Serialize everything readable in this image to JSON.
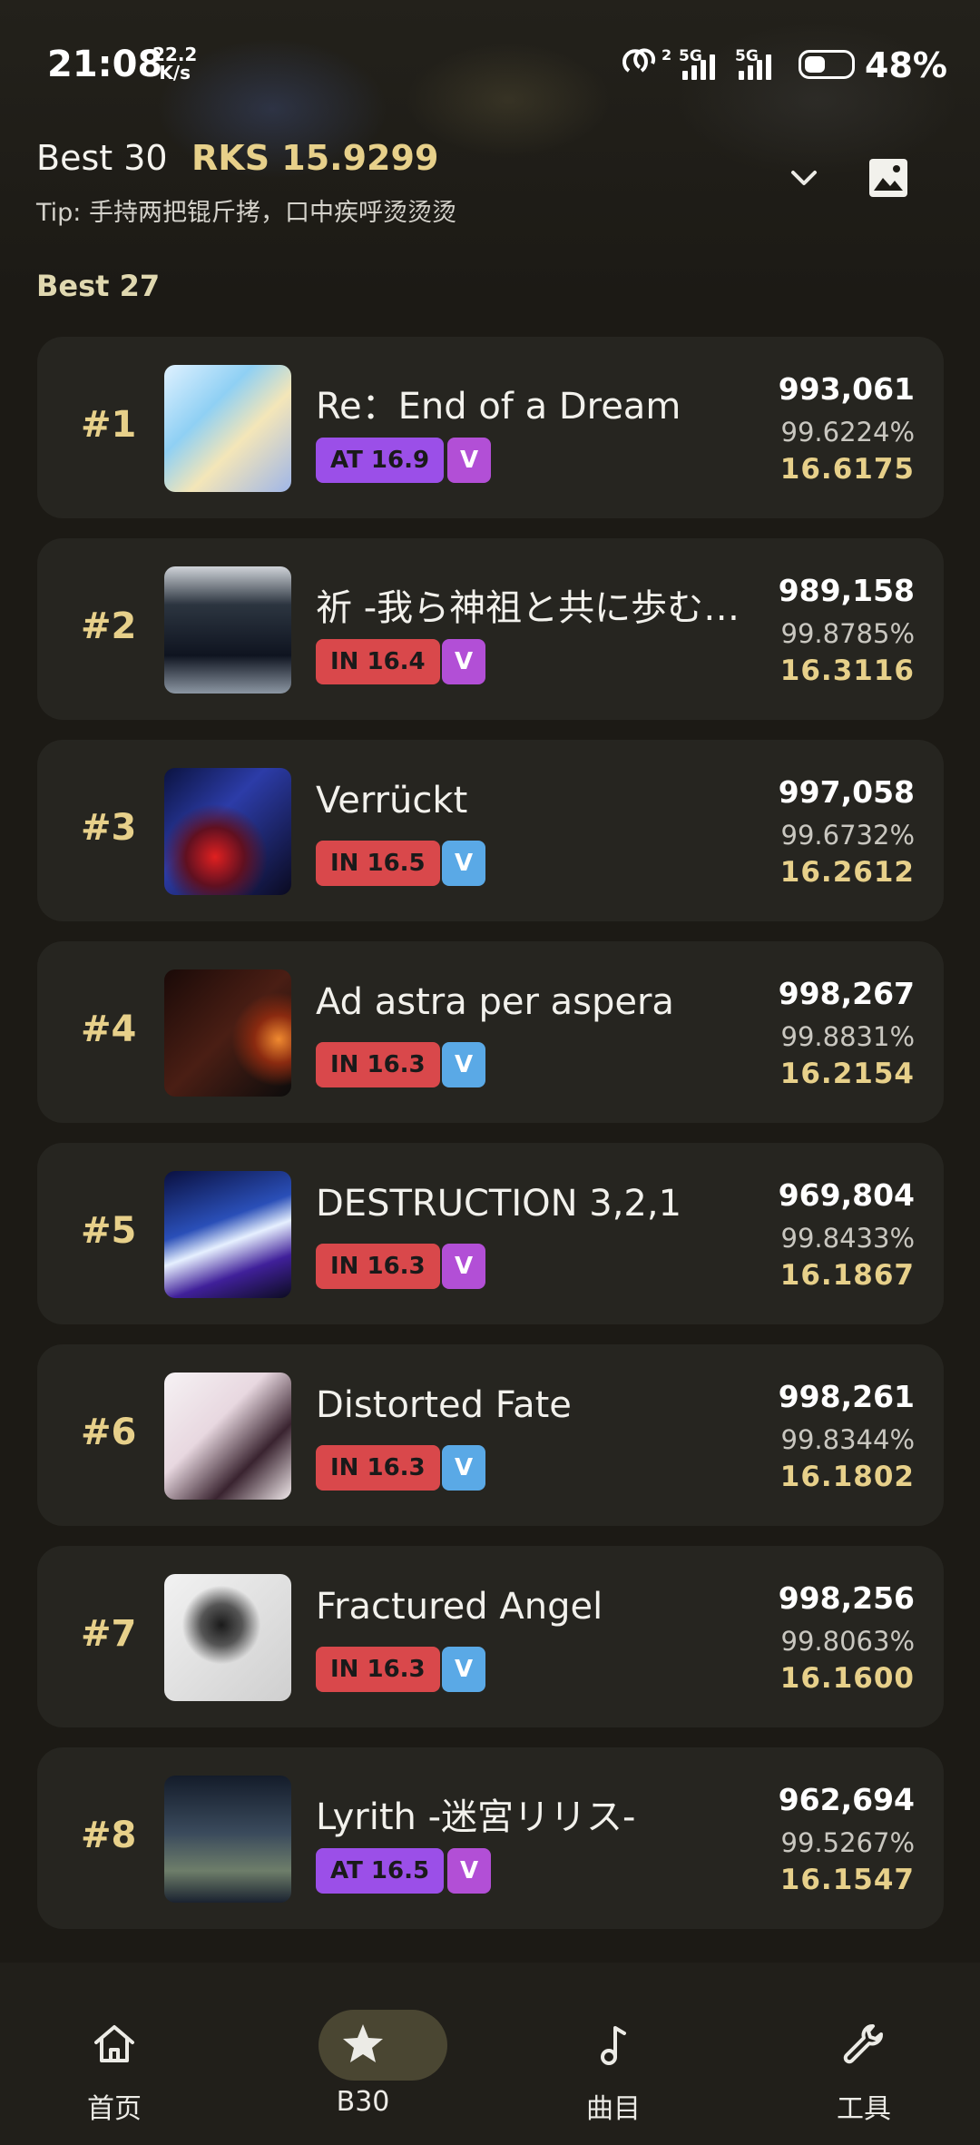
{
  "status_bar": {
    "time": "21:08",
    "net_speed_value": "22.2",
    "net_speed_unit": "K/s",
    "network_1": "5G",
    "network_2": "5G",
    "battery": "48%"
  },
  "header": {
    "title": "Best 30",
    "rks_label": "RKS 15.9299",
    "tip": "Tip: 手持两把锟斤拷，口中疾呼烫烫烫"
  },
  "section_label": "Best 27",
  "songs": [
    {
      "rank": "#1",
      "name": "Re：End of a Dream",
      "difficulty": "AT 16.9",
      "diff_type": "at",
      "badge": "V",
      "badge_color": "purple",
      "score": "993,061",
      "accuracy": "99.6224%",
      "rks": "16.6175"
    },
    {
      "rank": "#2",
      "name": "祈 -我ら神祖と共に歩む者なり-",
      "difficulty": "IN 16.4",
      "diff_type": "in",
      "badge": "V",
      "badge_color": "purple",
      "score": "989,158",
      "accuracy": "99.8785%",
      "rks": "16.3116"
    },
    {
      "rank": "#3",
      "name": "Verrückt",
      "difficulty": "IN 16.5",
      "diff_type": "in",
      "badge": "V",
      "badge_color": "blue",
      "score": "997,058",
      "accuracy": "99.6732%",
      "rks": "16.2612"
    },
    {
      "rank": "#4",
      "name": "Ad astra per aspera",
      "difficulty": "IN 16.3",
      "diff_type": "in",
      "badge": "V",
      "badge_color": "blue",
      "score": "998,267",
      "accuracy": "99.8831%",
      "rks": "16.2154"
    },
    {
      "rank": "#5",
      "name": "DESTRUCTION 3,2,1",
      "difficulty": "IN 16.3",
      "diff_type": "in",
      "badge": "V",
      "badge_color": "purple",
      "score": "969,804",
      "accuracy": "99.8433%",
      "rks": "16.1867"
    },
    {
      "rank": "#6",
      "name": "Distorted Fate",
      "difficulty": "IN 16.3",
      "diff_type": "in",
      "badge": "V",
      "badge_color": "blue",
      "score": "998,261",
      "accuracy": "99.8344%",
      "rks": "16.1802"
    },
    {
      "rank": "#7",
      "name": "Fractured Angel",
      "difficulty": "IN 16.3",
      "diff_type": "in",
      "badge": "V",
      "badge_color": "blue",
      "score": "998,256",
      "accuracy": "99.8063%",
      "rks": "16.1600"
    },
    {
      "rank": "#8",
      "name": "Lyrith -迷宮リリス-",
      "difficulty": "AT 16.5",
      "diff_type": "at",
      "badge": "V",
      "badge_color": "purple",
      "score": "962,694",
      "accuracy": "99.5267%",
      "rks": "16.1547"
    }
  ],
  "nav": [
    {
      "label": "首页",
      "icon": "home-icon"
    },
    {
      "label": "B30",
      "icon": "star-icon",
      "active": true
    },
    {
      "label": "曲目",
      "icon": "music-note-icon"
    },
    {
      "label": "工具",
      "icon": "wrench-icon"
    }
  ],
  "colors": {
    "accent_gold": "#e7d08a",
    "card_bg": "#262520",
    "page_bg": "#1c1a15",
    "diff_in": "#d9484b",
    "diff_at": "#9b4fe8",
    "badge_purple": "#b24fd6",
    "badge_blue": "#5aa9e6"
  }
}
